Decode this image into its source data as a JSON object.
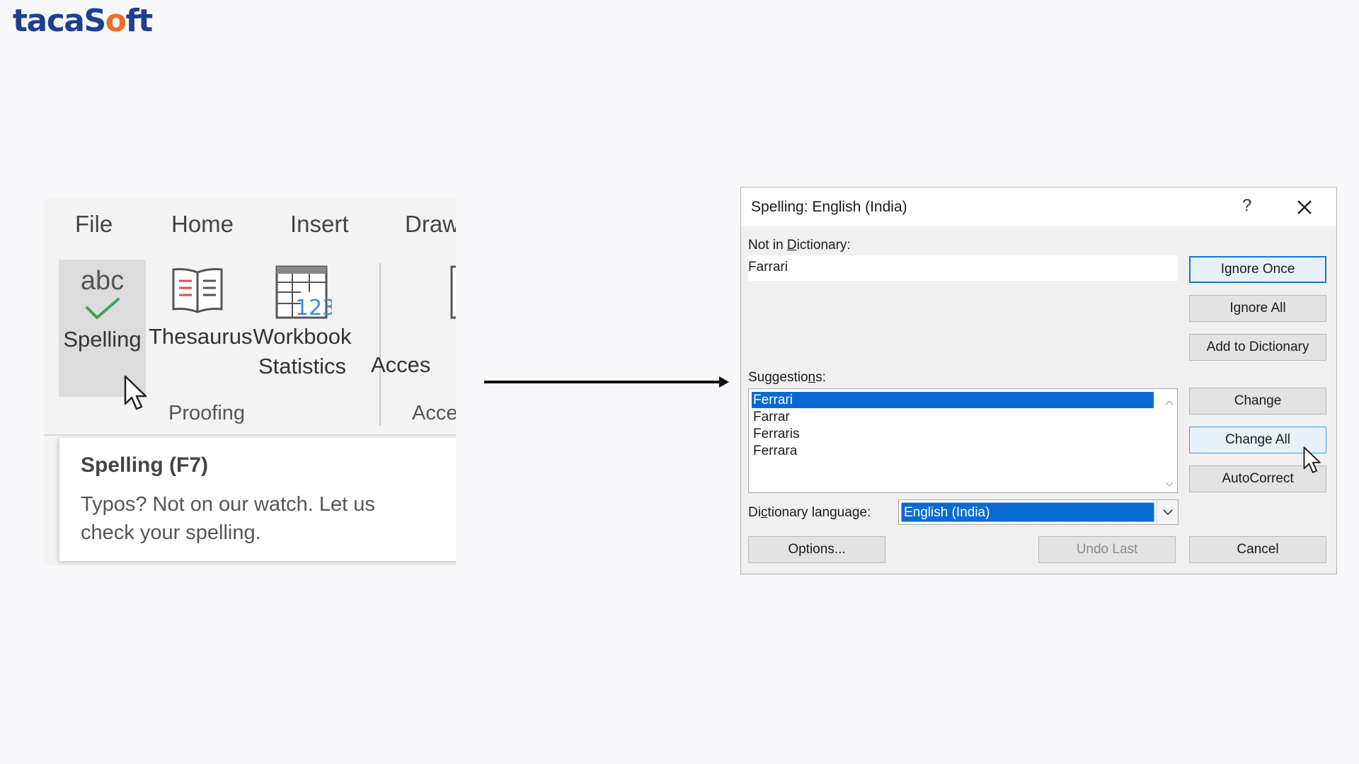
{
  "logo": {
    "part1": "taca",
    "part2": "S",
    "part3": "o",
    "part4": "ft"
  },
  "ribbon": {
    "tabs": [
      "File",
      "Home",
      "Insert",
      "Draw"
    ],
    "tools": {
      "spelling": {
        "icon_text": "abc",
        "label": "Spelling"
      },
      "thesaurus": {
        "label": "Thesaurus"
      },
      "workbook": {
        "label_line1": "Workbook",
        "label_line2": "Statistics",
        "icon_number": "123"
      },
      "access": {
        "label_line1": "C",
        "label_line2": "Acces"
      }
    },
    "groups": [
      "Proofing",
      "Acce"
    ],
    "tooltip": {
      "title": "Spelling (F7)",
      "body": "Typos? Not on our watch. Let us check your spelling."
    }
  },
  "dialog": {
    "title": "Spelling: English (India)",
    "help": "?",
    "not_in_dictionary": {
      "label_pre": "Not in ",
      "label_u": "D",
      "label_post": "ictionary:",
      "value": "Farrari"
    },
    "suggestions": {
      "label_pre": "Suggestio",
      "label_u": "n",
      "label_post": "s:",
      "items": [
        "Ferrari",
        "Farrar",
        "Ferraris",
        "Ferrara"
      ],
      "selected_index": 0
    },
    "dictionary_language": {
      "label_pre": "Di",
      "label_u": "c",
      "label_post": "tionary language:",
      "value": "English (India)"
    },
    "buttons": {
      "ignore_once": "Ignore Once",
      "ignore_all": "Ignore All",
      "add_to_dictionary": "Add to Dictionary",
      "change": "Change",
      "change_all": "Change All",
      "autocorrect": "AutoCorrect",
      "options": "Options...",
      "undo_last": "Undo Last",
      "cancel": "Cancel"
    },
    "colors": {
      "selection": "#0a6ad4",
      "primary_border": "#1777d6"
    }
  }
}
